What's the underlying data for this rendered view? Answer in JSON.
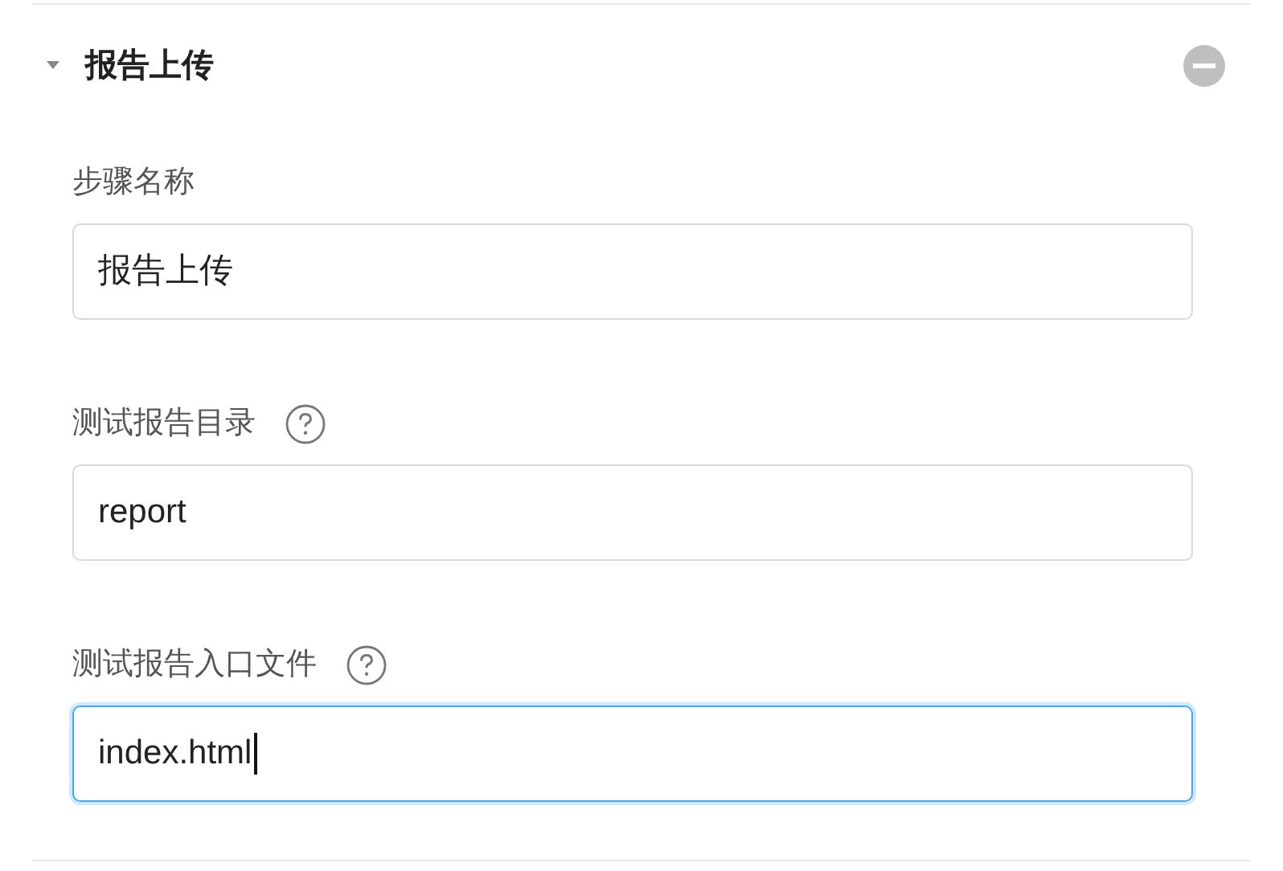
{
  "section": {
    "title": "报告上传",
    "expanded": true
  },
  "fields": [
    {
      "label": "步骤名称",
      "help": false,
      "value": "报告上传",
      "focused": false
    },
    {
      "label": "测试报告目录",
      "help": true,
      "value": "report",
      "focused": false
    },
    {
      "label": "测试报告入口文件",
      "help": true,
      "value": "index.html",
      "focused": true
    }
  ]
}
